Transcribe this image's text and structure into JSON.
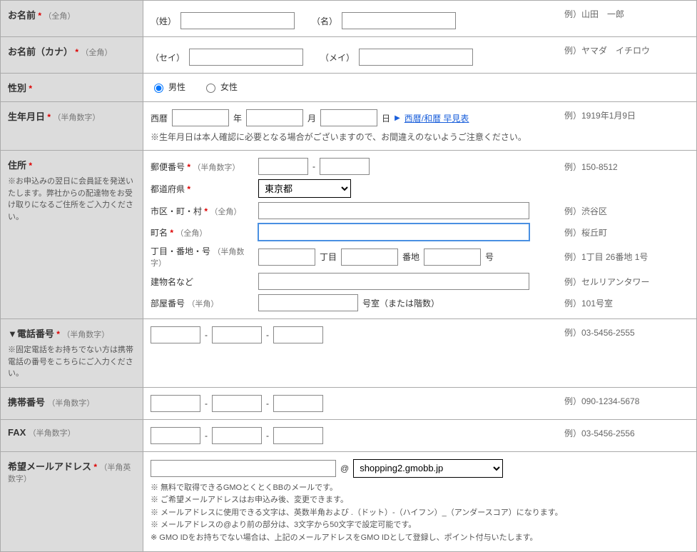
{
  "name": {
    "label": "お名前",
    "hint": "（全角）",
    "sei": "（姓）",
    "mei": "（名）",
    "example": "例）山田　一郎"
  },
  "kana": {
    "label": "お名前（カナ）",
    "hint": "（全角）",
    "sei": "（セイ）",
    "mei": "（メイ）",
    "example": "例）ヤマダ　イチロウ"
  },
  "gender": {
    "label": "性別",
    "male": "男性",
    "female": "女性"
  },
  "birth": {
    "label": "生年月日",
    "hint": "（半角数字）",
    "seireki": "西暦",
    "year": "年",
    "month": "月",
    "day": "日",
    "linkText": "西暦/和暦 早見表",
    "note": "※生年月日は本人確認に必要となる場合がございますので、お間違えのないようご注意ください。",
    "example": "例）1919年1月9日"
  },
  "address": {
    "label": "住所",
    "sub": "※お申込みの翌日に会員証を発送いたします。弊社からの配達物をお受け取りになるご住所をご入力ください。",
    "postal_label": "郵便番号",
    "postal_hint": "（半角数字）",
    "postal_sep": "-",
    "postal_example": "例）150-8512",
    "pref_label": "都道府県",
    "pref_value": "東京都",
    "city_label": "市区・町・村",
    "city_hint": "（全角）",
    "city_example": "例）渋谷区",
    "town_label": "町名",
    "town_hint": "（全角）",
    "town_example": "例）桜丘町",
    "chome_label": "丁目・番地・号",
    "chome_hint": "（半角数字）",
    "chome_unit": "丁目",
    "banchi_unit": "番地",
    "gou_unit": "号",
    "chome_example": "例）1丁目 26番地 1号",
    "building_label": "建物名など",
    "building_example": "例）セルリアンタワー",
    "room_label": "部屋番号",
    "room_hint": "（半角）",
    "room_suffix": "号室（または階数）",
    "room_example": "例）101号室"
  },
  "tel": {
    "label": "▼電話番号",
    "hint": "（半角数字）",
    "sub": "※固定電話をお持ちでない方は携帯電話の番号をこちらにご入力ください。",
    "sep": "-",
    "example": "例）03-5456-2555"
  },
  "mobile": {
    "label": "携帯番号",
    "hint": "（半角数字）",
    "sep": "-",
    "example": "例）090-1234-5678"
  },
  "fax": {
    "label": "FAX",
    "hint": "（半角数字）",
    "sep": "-",
    "example": "例）03-5456-2556"
  },
  "email": {
    "label": "希望メールアドレス",
    "hint": "（半角英数字）",
    "at": "@",
    "domain": "shopping2.gmobb.jp",
    "notes": [
      "※ 無料で取得できるGMOとくとくBBのメールです。",
      "※ ご希望メールアドレスはお申込み後、変更できます。",
      "※ メールアドレスに使用できる文字は、英数半角および .（ドット）-（ハイフン）_（アンダースコア）になります。",
      "※ メールアドレスの@より前の部分は、3文字から50文字で設定可能です。",
      "※ GMO IDをお持ちでない場合は、上記のメールアドレスをGMO IDとして登録し、ポイント付与いたします。"
    ]
  }
}
